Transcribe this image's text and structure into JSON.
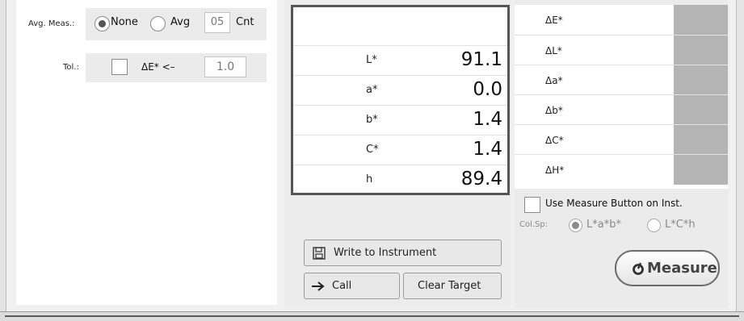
{
  "averaging": {
    "label": "Avg. Meas.:",
    "options": [
      "None",
      "Avg"
    ],
    "selected": "None",
    "count_value": "05",
    "count_unit": "Cnt"
  },
  "tolerance": {
    "label": "Tol.:",
    "condition": "ΔE* <–",
    "value": "1.0"
  },
  "measurement": {
    "rows": [
      {
        "label": "L*",
        "value": "91.1"
      },
      {
        "label": "a*",
        "value": "0.0"
      },
      {
        "label": "b*",
        "value": "1.4"
      },
      {
        "label": "C*",
        "value": "1.4"
      },
      {
        "label": "h",
        "value": "89.4"
      }
    ]
  },
  "buttons": {
    "write": "Write to Instrument",
    "call": "Call",
    "clear_target": "Clear Target",
    "measure": "Measure"
  },
  "difference": {
    "rows": [
      "ΔE*",
      "ΔL*",
      "Δa*",
      "Δb*",
      "ΔC*",
      "ΔH*"
    ],
    "swatch_color": "#b4b4b4"
  },
  "options": {
    "use_measure_button": "Use Measure Button on Inst.",
    "colorspace_label": "Col.Sp:",
    "colorspaces": [
      "L*a*b*",
      "L*C*h"
    ],
    "colorspace_selected": "L*a*b*"
  },
  "icons": {
    "write": "floppy-disk-icon",
    "call": "arrow-right-icon",
    "measure": "measure-drop-icon"
  }
}
